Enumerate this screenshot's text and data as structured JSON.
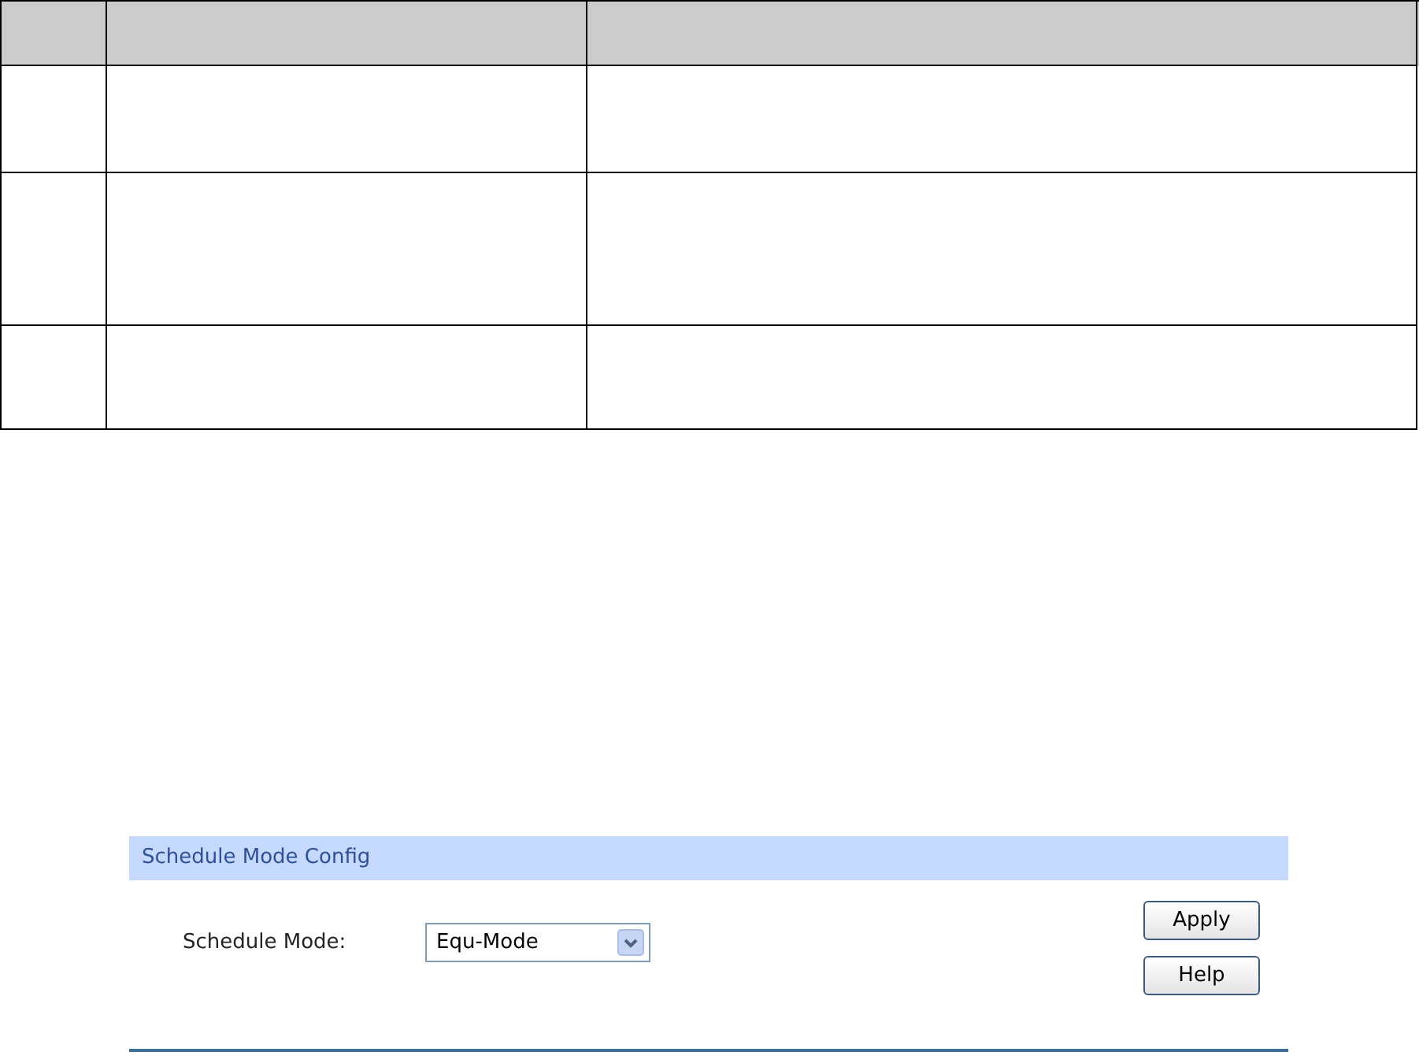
{
  "panel": {
    "title": "Schedule Mode Config",
    "fields": [
      {
        "kind": "select",
        "label": "Schedule Mode:",
        "value": "Equ-Mode"
      }
    ],
    "buttons": [
      "Apply",
      "Help"
    ]
  }
}
